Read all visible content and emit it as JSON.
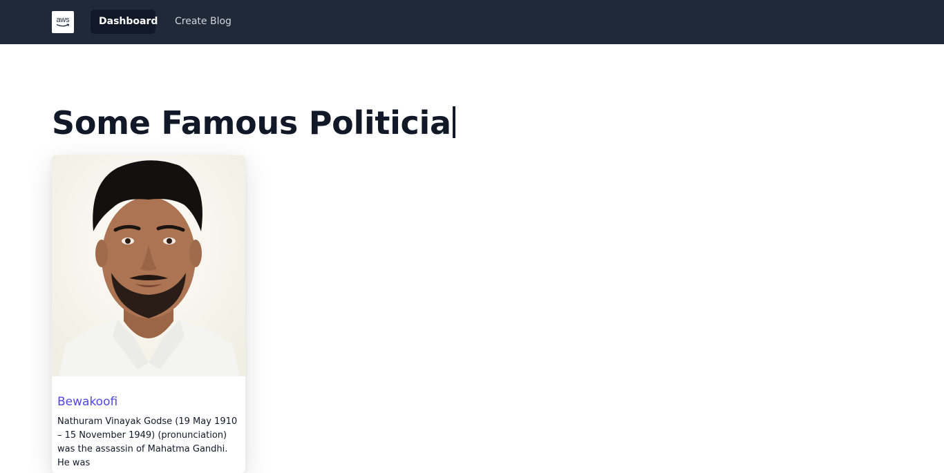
{
  "navbar": {
    "logo_text": "aws",
    "items": [
      {
        "label": "Dashboard",
        "active": true
      },
      {
        "label": "Create Blog",
        "active": false
      }
    ]
  },
  "main": {
    "title": "Some Famous Politicia"
  },
  "cards": [
    {
      "image_alt": "portrait photo",
      "title": "Bewakoofi",
      "description": "Nathuram Vinayak Godse (19 May 1910 – 15 November 1949) (pronunciation) was the assassin of Mahatma Gandhi. He was"
    }
  ],
  "colors": {
    "navbar_bg": "#1f2937",
    "active_bg": "#111827",
    "link": "#4f46e5",
    "text": "#111827"
  }
}
